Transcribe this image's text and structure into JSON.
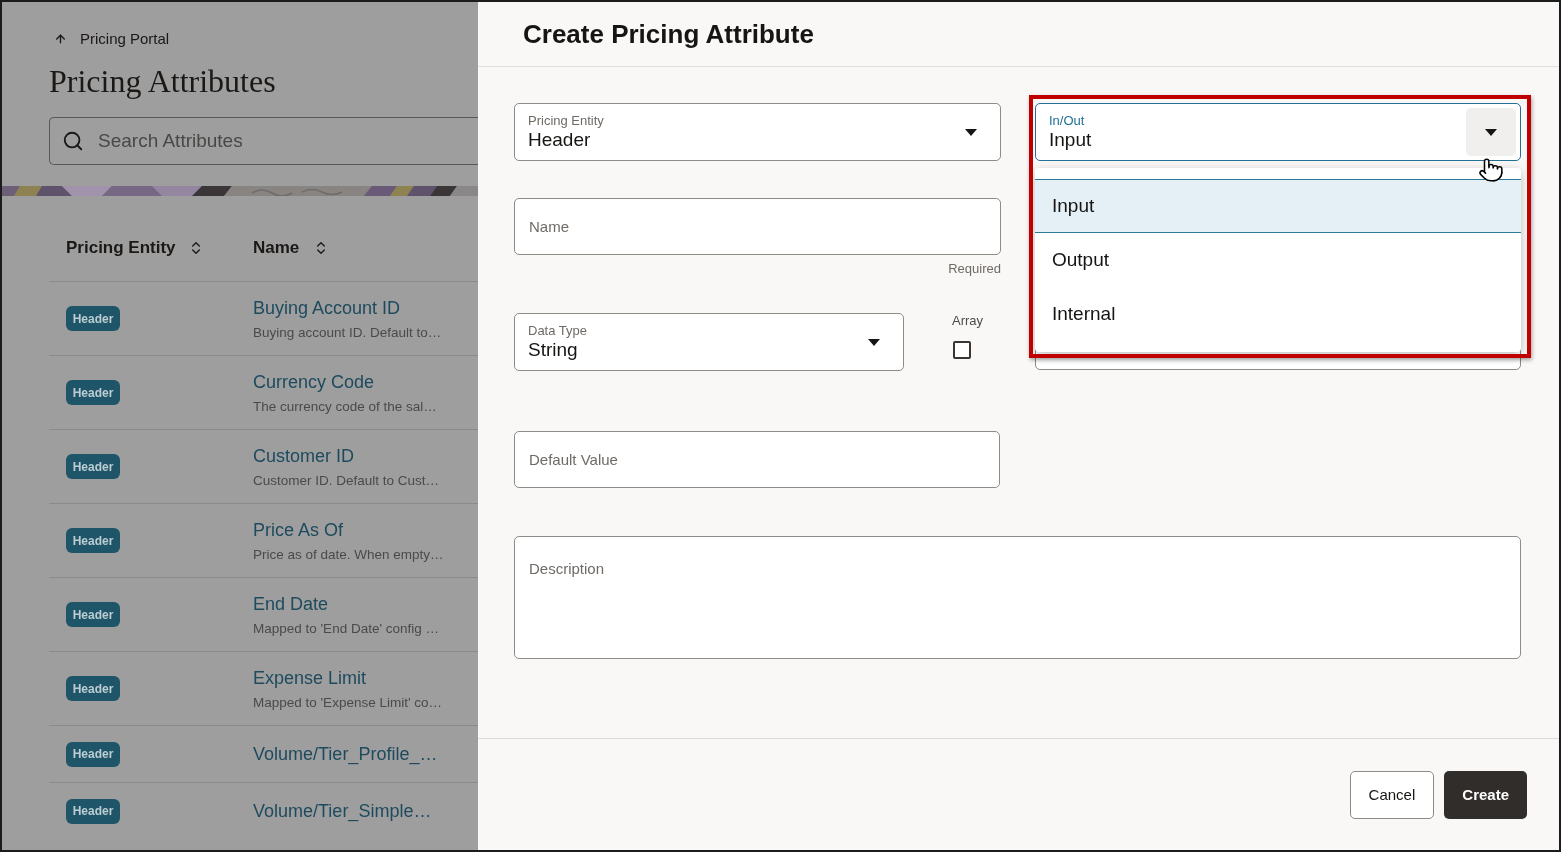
{
  "sidebar": {
    "breadcrumb": "Pricing Portal",
    "title": "Pricing Attributes",
    "search": {
      "placeholder": "Search Attributes"
    },
    "table": {
      "columns": [
        "Pricing Entity",
        "Name"
      ],
      "rows": [
        {
          "entity": "Header",
          "name": "Buying Account ID",
          "description": "Buying account ID. Default to…"
        },
        {
          "entity": "Header",
          "name": "Currency Code",
          "description": "The currency code of the sal…"
        },
        {
          "entity": "Header",
          "name": "Customer ID",
          "description": "Customer ID. Default to Cust…"
        },
        {
          "entity": "Header",
          "name": "Price As Of",
          "description": "Price as of date. When empty…"
        },
        {
          "entity": "Header",
          "name": "End Date",
          "description": "Mapped to 'End Date' config …"
        },
        {
          "entity": "Header",
          "name": "Expense Limit",
          "description": "Mapped to 'Expense Limit' co…"
        },
        {
          "entity": "Header",
          "name": "Volume/Tier_Profile_…"
        },
        {
          "entity": "Header",
          "name": "Volume/Tier_Simple…"
        }
      ]
    }
  },
  "dialog": {
    "title": "Create Pricing Attribute",
    "pricing_entity": {
      "label": "Pricing Entity",
      "value": "Header"
    },
    "in_out": {
      "label": "In/Out",
      "value": "Input",
      "expanded": true,
      "options": [
        {
          "label": "Input",
          "selected": true
        },
        {
          "label": "Output",
          "selected": false
        },
        {
          "label": "Internal",
          "selected": false
        }
      ]
    },
    "name": {
      "placeholder": "Name",
      "helper": "Required"
    },
    "data_type": {
      "label": "Data Type",
      "value": "String"
    },
    "array": {
      "label": "Array",
      "checked": false
    },
    "default_value": {
      "placeholder": "Default Value"
    },
    "description": {
      "placeholder": "Description"
    },
    "buttons": [
      {
        "label": "Cancel",
        "kind": "secondary"
      },
      {
        "label": "Create",
        "kind": "primary"
      }
    ]
  }
}
